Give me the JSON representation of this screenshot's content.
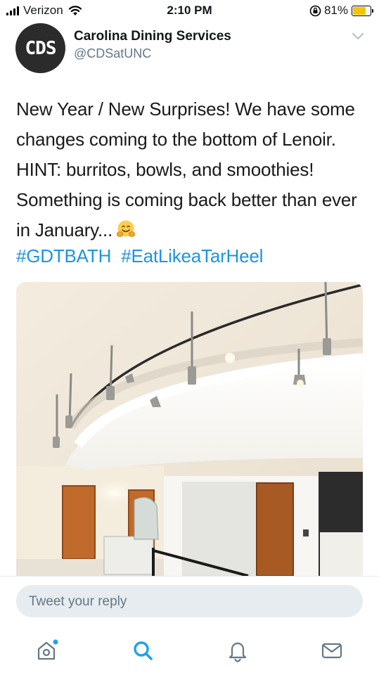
{
  "status_bar": {
    "carrier": "Verizon",
    "time": "2:10 PM",
    "battery_percent": "81%",
    "battery_level": 0.81,
    "battery_color": "#f5c400"
  },
  "tweet": {
    "avatar_text": "CDS",
    "display_name": "Carolina Dining Services",
    "handle": "@CDSatUNC",
    "body": "New Year / New Surprises! We have some changes coming to the bottom of Lenoir. HINT: burritos, bowls, and smoothies! Something is coming back better than ever in January...",
    "emoji": "hugging-face",
    "hashtags": [
      "#GDTBATH",
      "#EatLikeaTarHeel"
    ],
    "hashtag_color": "#1b95e0"
  },
  "reply": {
    "placeholder": "Tweet your reply"
  },
  "tab_bar": {
    "items": [
      "home-icon",
      "search-icon",
      "notifications-icon",
      "messages-icon"
    ],
    "accent": "#1da1f2"
  }
}
